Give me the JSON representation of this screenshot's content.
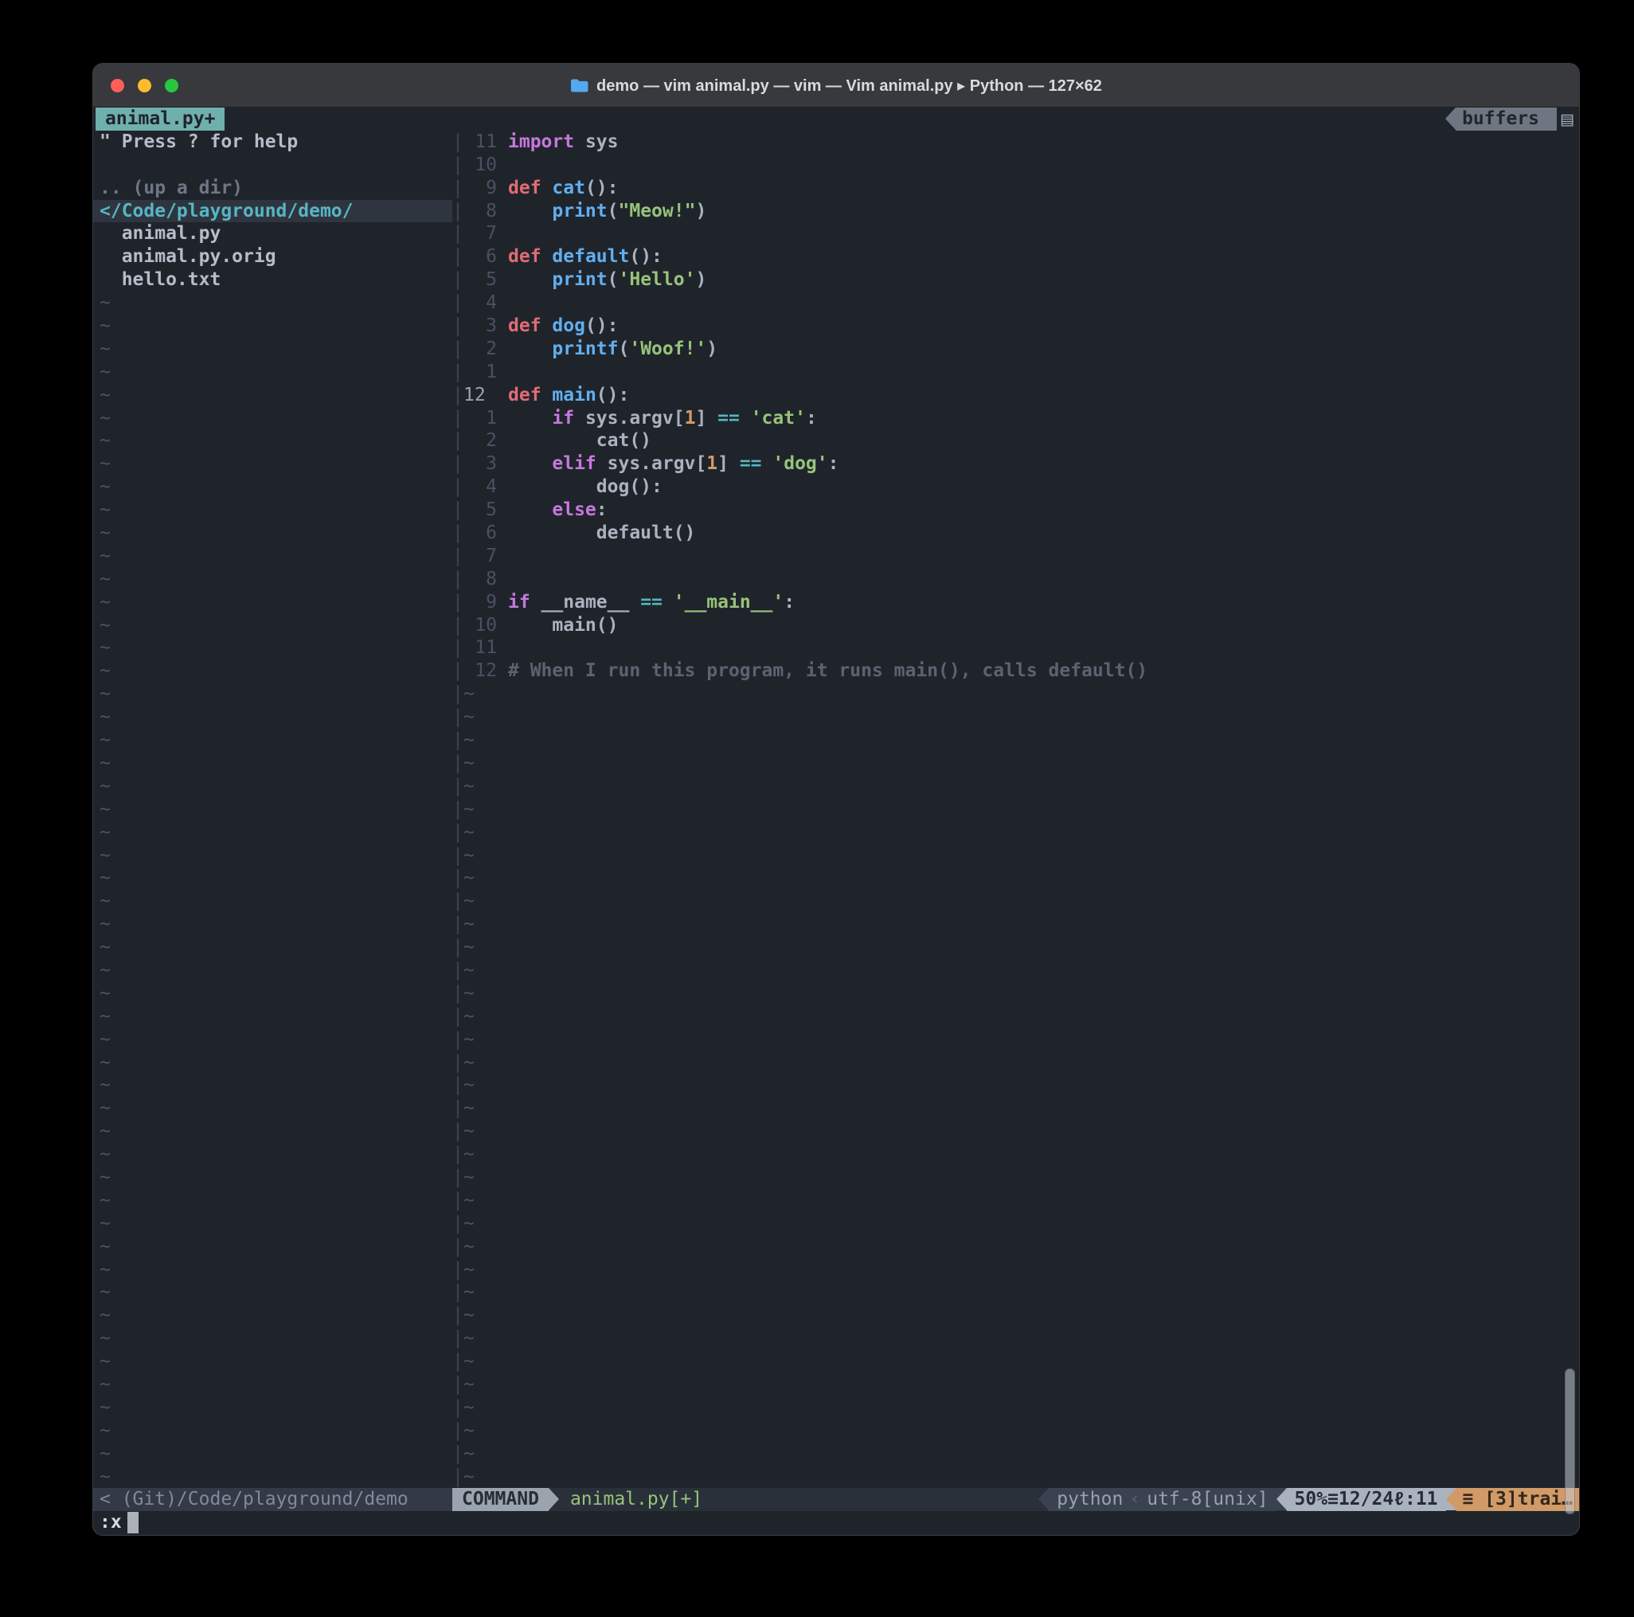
{
  "window": {
    "title": "demo — vim animal.py — vim — Vim animal.py ▸ Python — 127×62"
  },
  "tabline": {
    "tab_label": "animal.py+",
    "buffers_label": "buffers",
    "corner_icon": "▤"
  },
  "terminal": {
    "content_rows": 59,
    "tilde": "~",
    "separator": "|"
  },
  "sidebar": {
    "lines": [
      {
        "tokens": [
          [
            "\" Press ? for help",
            "sfg"
          ]
        ]
      },
      {
        "tokens": []
      },
      {
        "tokens": [
          [
            ".. (up a dir)",
            "sdim"
          ]
        ]
      },
      {
        "hl": true,
        "tokens": [
          [
            "</Code/playground/demo/",
            "sdir"
          ]
        ]
      },
      {
        "tokens": [
          [
            "  animal.py",
            "sfg"
          ]
        ]
      },
      {
        "tokens": [
          [
            "  animal.py.orig",
            "sfg"
          ]
        ]
      },
      {
        "tokens": [
          [
            "  hello.txt",
            "sfg"
          ]
        ]
      }
    ]
  },
  "editor": {
    "lines": [
      {
        "num": "11",
        "tokens": [
          [
            "import",
            "kw"
          ],
          [
            " sys",
            "fg"
          ]
        ]
      },
      {
        "num": "10",
        "tokens": []
      },
      {
        "num": " 9",
        "tokens": [
          [
            "def",
            "rd"
          ],
          [
            " ",
            "fg"
          ],
          [
            "cat",
            "fn"
          ],
          [
            "():",
            "fg"
          ]
        ]
      },
      {
        "num": " 8",
        "tokens": [
          [
            "    ",
            "fg"
          ],
          [
            "print",
            "fn"
          ],
          [
            "(",
            "fg"
          ],
          [
            "\"Meow!\"",
            "st"
          ],
          [
            ")",
            "fg"
          ]
        ]
      },
      {
        "num": " 7",
        "tokens": []
      },
      {
        "num": " 6",
        "tokens": [
          [
            "def",
            "rd"
          ],
          [
            " ",
            "fg"
          ],
          [
            "default",
            "fn"
          ],
          [
            "():",
            "fg"
          ]
        ]
      },
      {
        "num": " 5",
        "tokens": [
          [
            "    ",
            "fg"
          ],
          [
            "print",
            "fn"
          ],
          [
            "(",
            "fg"
          ],
          [
            "'Hello'",
            "st"
          ],
          [
            ")",
            "fg"
          ]
        ]
      },
      {
        "num": " 4",
        "tokens": []
      },
      {
        "num": " 3",
        "tokens": [
          [
            "def",
            "rd"
          ],
          [
            " ",
            "fg"
          ],
          [
            "dog",
            "fn"
          ],
          [
            "():",
            "fg"
          ]
        ]
      },
      {
        "num": " 2",
        "tokens": [
          [
            "    ",
            "fg"
          ],
          [
            "printf",
            "fn"
          ],
          [
            "(",
            "fg"
          ],
          [
            "'Woof!'",
            "st"
          ],
          [
            ")",
            "fg"
          ]
        ]
      },
      {
        "num": " 1",
        "tokens": []
      },
      {
        "num": "12",
        "cur": true,
        "tokens": [
          [
            "def",
            "rd"
          ],
          [
            " ",
            "fg"
          ],
          [
            "main",
            "fn"
          ],
          [
            "():",
            "fg"
          ]
        ]
      },
      {
        "num": " 1",
        "tokens": [
          [
            "    ",
            "fg"
          ],
          [
            "if",
            "kw"
          ],
          [
            " sys.argv[",
            "fg"
          ],
          [
            "1",
            "nu"
          ],
          [
            "] ",
            "fg"
          ],
          [
            "==",
            "op"
          ],
          [
            " ",
            "fg"
          ],
          [
            "'cat'",
            "st"
          ],
          [
            ":",
            "fg"
          ]
        ]
      },
      {
        "num": " 2",
        "tokens": [
          [
            "        cat()",
            "fg"
          ]
        ]
      },
      {
        "num": " 3",
        "tokens": [
          [
            "    ",
            "fg"
          ],
          [
            "elif",
            "kw"
          ],
          [
            " sys.argv[",
            "fg"
          ],
          [
            "1",
            "nu"
          ],
          [
            "] ",
            "fg"
          ],
          [
            "==",
            "op"
          ],
          [
            " ",
            "fg"
          ],
          [
            "'dog'",
            "st"
          ],
          [
            ":",
            "fg"
          ]
        ]
      },
      {
        "num": " 4",
        "tokens": [
          [
            "        dog():",
            "fg"
          ]
        ]
      },
      {
        "num": " 5",
        "tokens": [
          [
            "    ",
            "fg"
          ],
          [
            "else",
            "kw"
          ],
          [
            ":",
            "fg"
          ]
        ]
      },
      {
        "num": " 6",
        "tokens": [
          [
            "        default()",
            "fg"
          ]
        ]
      },
      {
        "num": " 7",
        "tokens": []
      },
      {
        "num": " 8",
        "tokens": []
      },
      {
        "num": " 9",
        "tokens": [
          [
            "if",
            "kw"
          ],
          [
            " __name__ ",
            "fg"
          ],
          [
            "==",
            "op"
          ],
          [
            " ",
            "fg"
          ],
          [
            "'__main__'",
            "st"
          ],
          [
            ":",
            "fg"
          ]
        ]
      },
      {
        "num": "10",
        "tokens": [
          [
            "    main()",
            "fg"
          ]
        ]
      },
      {
        "num": "11",
        "tokens": []
      },
      {
        "num": "12",
        "tokens": [
          [
            "# When I run this program, it runs main(), calls default()",
            "cm"
          ]
        ]
      }
    ]
  },
  "statusbar": {
    "left_path": "< (Git)/Code/playground/demo",
    "mode": "COMMAND",
    "file": "animal.py[+]",
    "filetype": "python",
    "separator_glyph": "‹",
    "encoding": "utf-8[unix]",
    "position": "50%≡12/24ℓ:11",
    "warning": "≡ [3]trai…"
  },
  "cmdline": {
    "text": ":x"
  },
  "colors": {
    "fg": "#abb2bf",
    "kw": "#c678dd",
    "rd": "#e06c75",
    "fn": "#61afef",
    "st": "#98c379",
    "nu": "#d19a66",
    "op": "#56b6c2",
    "cm": "#5c6370",
    "tilde": "#4b5263",
    "sfg": "#b6bdc9",
    "sdim": "#6e7785",
    "sdir": "#56b6c2"
  }
}
